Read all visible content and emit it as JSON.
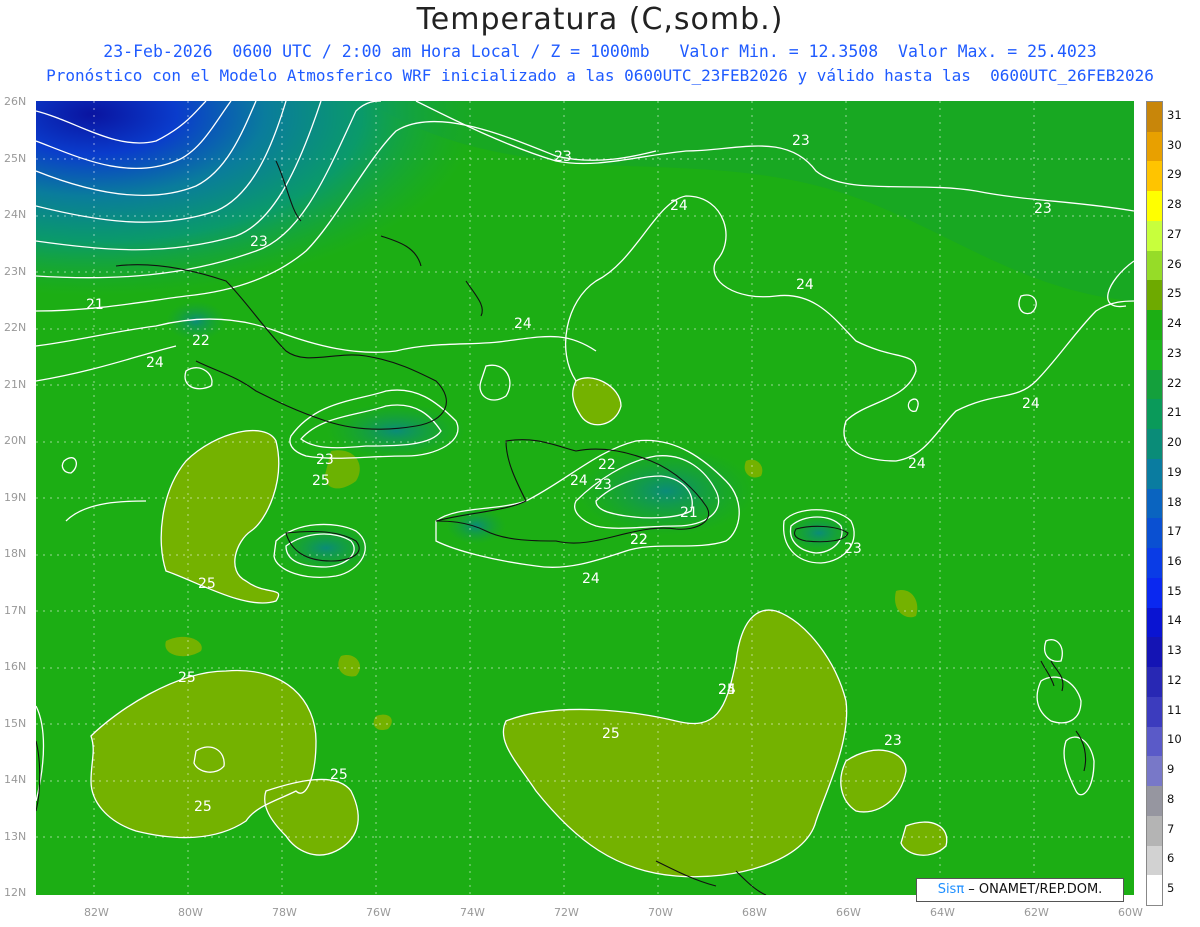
{
  "title": "Temperatura (C,somb.)",
  "subtitle_1": "23-Feb-2026  0600 UTC / 2:00 am Hora Local / Z = 1000mb   Valor Min. = 12.3508  Valor Max. = 25.4023",
  "subtitle_2": "Pronóstico con el Modelo Atmosferico WRF inicializado a las 0600UTC_23FEB2026 y válido hasta las  0600UTC_26FEB2026",
  "credit": {
    "sis": "Sisπ",
    "rest": " – ONAMET/REP.DOM."
  },
  "lat_labels": [
    "26N",
    "25N",
    "24N",
    "23N",
    "22N",
    "21N",
    "20N",
    "19N",
    "18N",
    "17N",
    "16N",
    "15N",
    "14N",
    "13N",
    "12N"
  ],
  "lon_labels": [
    "82W",
    "80W",
    "78W",
    "76W",
    "74W",
    "72W",
    "70W",
    "68W",
    "66W",
    "64W",
    "62W",
    "60W"
  ],
  "contour_labels": [
    "23",
    "23",
    "23",
    "23",
    "24",
    "24",
    "24",
    "24",
    "24",
    "24",
    "21",
    "22",
    "24",
    "22",
    "23",
    "25",
    "22",
    "23",
    "21",
    "22",
    "24",
    "23",
    "25",
    "25",
    "25",
    "25",
    "25",
    "24",
    "23",
    "25"
  ],
  "legend": {
    "values": [
      "31",
      "30",
      "29",
      "28",
      "27",
      "26",
      "25",
      "24",
      "23",
      "22",
      "21",
      "20",
      "19",
      "18",
      "17",
      "16",
      "15",
      "14",
      "13",
      "12",
      "11",
      "10",
      "9",
      "8",
      "7",
      "6",
      "5"
    ],
    "colors": [
      "#c8860a",
      "#e8a000",
      "#ffc400",
      "#ffff00",
      "#c8ff3c",
      "#96dc28",
      "#6eaa00",
      "#1cae14",
      "#1cb41c",
      "#14a03c",
      "#0a9a5a",
      "#0a8c78",
      "#0a7ca0",
      "#0a64c0",
      "#0a50d2",
      "#0a3ce6",
      "#0a28f0",
      "#0a14d2",
      "#1414b4",
      "#2828b4",
      "#3c3cbe",
      "#5a5ac8",
      "#7878c8",
      "#9696a0",
      "#b4b4b4",
      "#d2d2d2",
      "#ffffff"
    ]
  },
  "colors": {
    "field": "#1cae14",
    "warm": "#74b200",
    "cool_teal": "#14a03c",
    "deep": "#0a28c8",
    "contour": "#ffffff",
    "coast": "#111111"
  }
}
